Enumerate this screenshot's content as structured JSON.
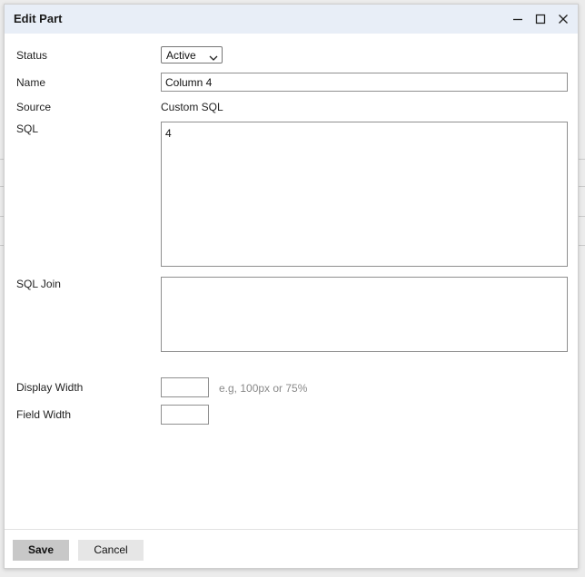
{
  "dialog": {
    "title": "Edit Part",
    "minimize_icon": "minimize-icon",
    "maximize_icon": "maximize-icon",
    "close_icon": "close-icon"
  },
  "form": {
    "status": {
      "label": "Status",
      "value": "Active"
    },
    "name": {
      "label": "Name",
      "value": "Column 4"
    },
    "source": {
      "label": "Source",
      "value": "Custom SQL"
    },
    "sql": {
      "label": "SQL",
      "value": "4"
    },
    "sql_join": {
      "label": "SQL Join",
      "value": ""
    },
    "display_width": {
      "label": "Display Width",
      "value": "",
      "hint": "e.g, 100px or 75%"
    },
    "field_width": {
      "label": "Field Width",
      "value": ""
    }
  },
  "footer": {
    "save_label": "Save",
    "cancel_label": "Cancel"
  },
  "colors": {
    "titlebar_bg": "#e8eef7",
    "save_bg": "#c8c8c8",
    "cancel_bg": "#e6e6e6"
  }
}
